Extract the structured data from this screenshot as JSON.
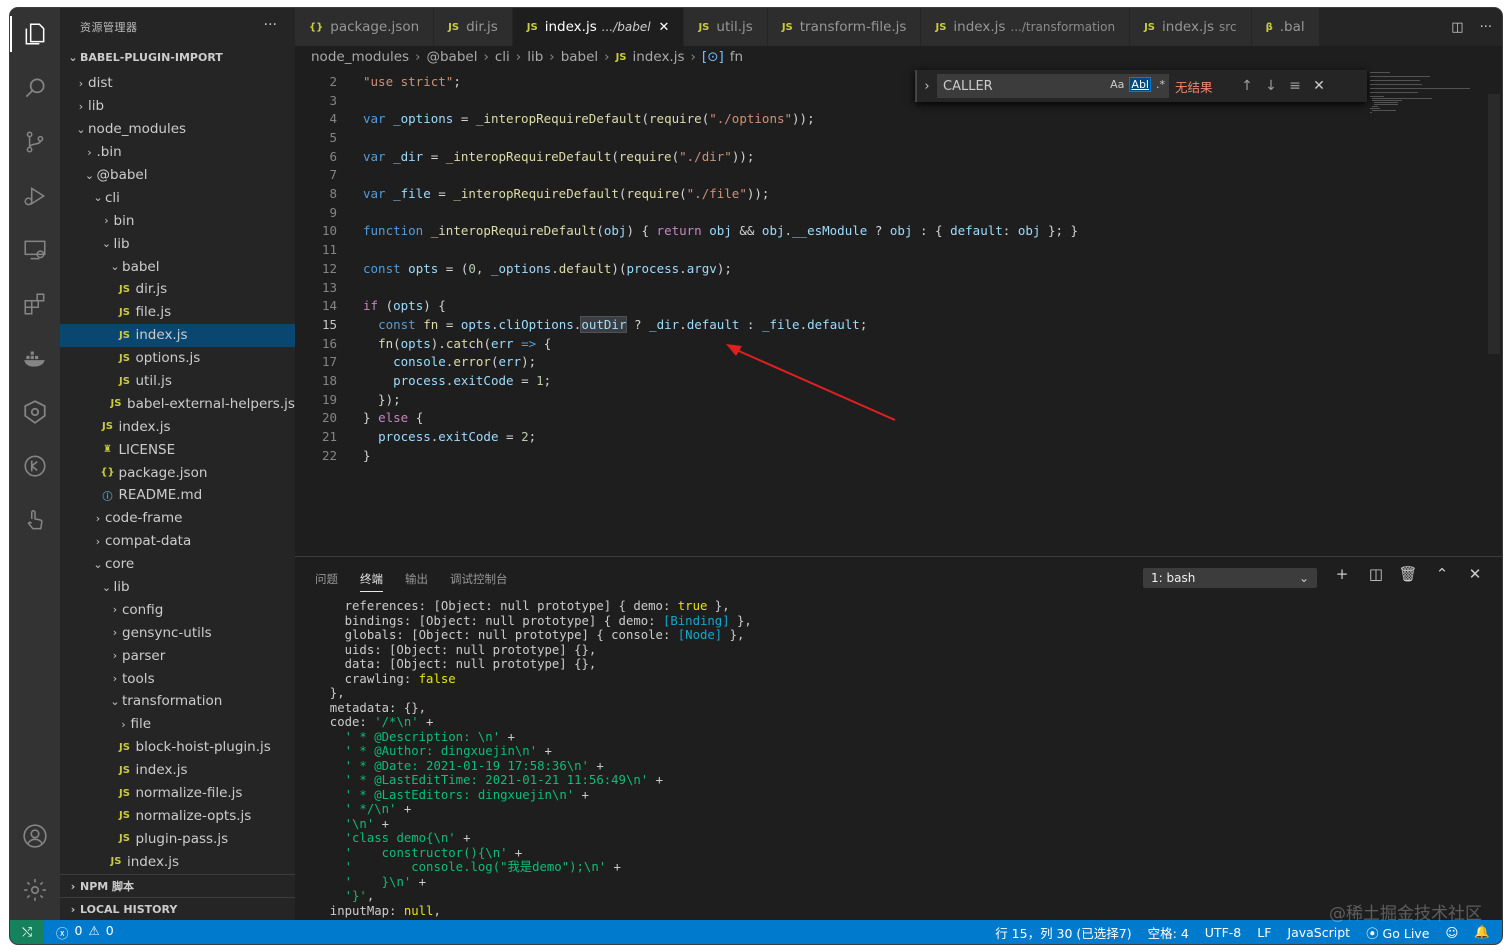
{
  "sidebar": {
    "title": "资源管理器",
    "more": "···",
    "root": "BABEL-PLUGIN-IMPORT",
    "tree": [
      {
        "depth": 0,
        "type": "folder",
        "open": false,
        "label": "dist"
      },
      {
        "depth": 0,
        "type": "folder",
        "open": false,
        "label": "lib"
      },
      {
        "depth": 0,
        "type": "folder",
        "open": true,
        "label": "node_modules"
      },
      {
        "depth": 1,
        "type": "folder",
        "open": false,
        "label": ".bin"
      },
      {
        "depth": 1,
        "type": "folder",
        "open": true,
        "label": "@babel"
      },
      {
        "depth": 2,
        "type": "folder",
        "open": true,
        "label": "cli"
      },
      {
        "depth": 3,
        "type": "folder",
        "open": false,
        "label": "bin"
      },
      {
        "depth": 3,
        "type": "folder",
        "open": true,
        "label": "lib"
      },
      {
        "depth": 4,
        "type": "folder",
        "open": true,
        "label": "babel"
      },
      {
        "depth": 5,
        "type": "js",
        "label": "dir.js"
      },
      {
        "depth": 5,
        "type": "js",
        "label": "file.js"
      },
      {
        "depth": 5,
        "type": "js",
        "label": "index.js",
        "selected": true
      },
      {
        "depth": 5,
        "type": "js",
        "label": "options.js"
      },
      {
        "depth": 5,
        "type": "js",
        "label": "util.js"
      },
      {
        "depth": 4,
        "type": "js",
        "label": "babel-external-helpers.js"
      },
      {
        "depth": 3,
        "type": "js",
        "label": "index.js"
      },
      {
        "depth": 3,
        "type": "license",
        "label": "LICENSE"
      },
      {
        "depth": 3,
        "type": "json",
        "label": "package.json"
      },
      {
        "depth": 3,
        "type": "info",
        "label": "README.md"
      },
      {
        "depth": 2,
        "type": "folder",
        "open": false,
        "label": "code-frame"
      },
      {
        "depth": 2,
        "type": "folder",
        "open": false,
        "label": "compat-data"
      },
      {
        "depth": 2,
        "type": "folder",
        "open": true,
        "label": "core"
      },
      {
        "depth": 3,
        "type": "folder",
        "open": true,
        "label": "lib"
      },
      {
        "depth": 4,
        "type": "folder",
        "open": false,
        "label": "config"
      },
      {
        "depth": 4,
        "type": "folder",
        "open": false,
        "label": "gensync-utils"
      },
      {
        "depth": 4,
        "type": "folder",
        "open": false,
        "label": "parser"
      },
      {
        "depth": 4,
        "type": "folder",
        "open": false,
        "label": "tools"
      },
      {
        "depth": 4,
        "type": "folder",
        "open": true,
        "label": "transformation"
      },
      {
        "depth": 5,
        "type": "folder",
        "open": false,
        "label": "file"
      },
      {
        "depth": 5,
        "type": "js",
        "label": "block-hoist-plugin.js"
      },
      {
        "depth": 5,
        "type": "js",
        "label": "index.js"
      },
      {
        "depth": 5,
        "type": "js",
        "label": "normalize-file.js"
      },
      {
        "depth": 5,
        "type": "js",
        "label": "normalize-opts.js"
      },
      {
        "depth": 5,
        "type": "js",
        "label": "plugin-pass.js"
      },
      {
        "depth": 4,
        "type": "js",
        "label": "index.js"
      }
    ],
    "npm_section": "NPM 脚本",
    "history_section": "LOCAL HISTORY"
  },
  "tabs": [
    {
      "icon": "{}",
      "label": "package.json",
      "hint": ""
    },
    {
      "icon": "JS",
      "label": "dir.js",
      "hint": ""
    },
    {
      "icon": "JS",
      "label": "index.js",
      "hint": ".../babel",
      "active": true
    },
    {
      "icon": "JS",
      "label": "util.js",
      "hint": ""
    },
    {
      "icon": "JS",
      "label": "transform-file.js",
      "hint": ""
    },
    {
      "icon": "JS",
      "label": "index.js",
      "hint": ".../transformation"
    },
    {
      "icon": "JS",
      "label": "index.js",
      "hint": "src"
    },
    {
      "icon": "β",
      "label": ".bal",
      "hint": ""
    }
  ],
  "breadcrumb": [
    "node_modules",
    "@babel",
    "cli",
    "lib",
    "babel",
    "index.js",
    "fn"
  ],
  "code": {
    "current_line": 15,
    "lines": [
      {
        "n": 2,
        "html": "<span class='str'>\"use strict\"</span>;"
      },
      {
        "n": 3,
        "html": ""
      },
      {
        "n": 4,
        "html": "<span class='kw'>var</span> <span class='var'>_options</span> = <span class='fn'>_interopRequireDefault</span>(<span class='fn'>require</span>(<span class='str'>\"./options\"</span>));"
      },
      {
        "n": 5,
        "html": ""
      },
      {
        "n": 6,
        "html": "<span class='kw'>var</span> <span class='var'>_dir</span> = <span class='fn'>_interopRequireDefault</span>(<span class='fn'>require</span>(<span class='str'>\"./dir\"</span>));"
      },
      {
        "n": 7,
        "html": ""
      },
      {
        "n": 8,
        "html": "<span class='kw'>var</span> <span class='var'>_file</span> = <span class='fn'>_interopRequireDefault</span>(<span class='fn'>require</span>(<span class='str'>\"./file\"</span>));"
      },
      {
        "n": 9,
        "html": ""
      },
      {
        "n": 10,
        "html": "<span class='kw'>function</span> <span class='fn'>_interopRequireDefault</span>(<span class='var'>obj</span>) { <span class='ctl'>return</span> <span class='var'>obj</span> &amp;&amp; <span class='var'>obj</span>.<span class='var'>__esModule</span> ? <span class='var'>obj</span> : { <span class='var'>default</span>: <span class='var'>obj</span> }; }"
      },
      {
        "n": 11,
        "html": ""
      },
      {
        "n": 12,
        "html": "<span class='kw'>const</span> <span class='var'>opts</span> = (<span class='num'>0</span>, <span class='var'>_options</span>.<span class='fn'>default</span>)(<span class='var'>process</span>.<span class='var'>argv</span>);"
      },
      {
        "n": 13,
        "html": ""
      },
      {
        "n": 14,
        "html": "<span class='ctl'>if</span> (<span class='var'>opts</span>) {"
      },
      {
        "n": 15,
        "html": "  <span class='kw'>const</span> <span class='fn'>fn</span> = <span class='var'>opts</span>.<span class='var'>cliOptions</span>.<span class='var hl'>outDir</span> ? <span class='var'>_dir</span>.<span class='var'>default</span> : <span class='var'>_file</span>.<span class='var'>default</span>;"
      },
      {
        "n": 16,
        "html": "  <span class='fn'>fn</span>(<span class='var'>opts</span>).<span class='fn'>catch</span>(<span class='var'>err</span> <span class='kw'>=&gt;</span> {"
      },
      {
        "n": 17,
        "html": "    <span class='var'>console</span>.<span class='fn'>error</span>(<span class='var'>err</span>);"
      },
      {
        "n": 18,
        "html": "    <span class='var'>process</span>.<span class='var'>exitCode</span> = <span class='num'>1</span>;"
      },
      {
        "n": 19,
        "html": "  });"
      },
      {
        "n": 20,
        "html": "} <span class='ctl'>else</span> {"
      },
      {
        "n": 21,
        "html": "  <span class='var'>process</span>.<span class='var'>exitCode</span> = <span class='num'>2</span>;"
      },
      {
        "n": 22,
        "html": "}"
      }
    ]
  },
  "find": {
    "value": "CALLER",
    "opt_case": "Aa",
    "opt_word": "Abl",
    "opt_regex": ".*",
    "result": "无结果"
  },
  "panel": {
    "tabs": [
      "问题",
      "终端",
      "输出",
      "调试控制台"
    ],
    "active_tab": 1,
    "terminal_select": "1: bash",
    "lines": [
      "    references: [Object: null prototype] { demo: <span class='ty'>true</span> },",
      "    bindings: [Object: null prototype] { demo: <span class='tc'>[Binding]</span> },",
      "    globals: [Object: null prototype] { console: <span class='tc'>[Node]</span> },",
      "    uids: [Object: null prototype] {},",
      "    data: [Object: null prototype] {},",
      "    crawling: <span class='ty'>false</span>",
      "  },",
      "  metadata: {},",
      "  code: <span class='tg'>'/*\\n'</span> +",
      "    <span class='tg'>' * @Description: \\n'</span> +",
      "    <span class='tg'>' * @Author: dingxuejin\\n'</span> +",
      "    <span class='tg'>' * @Date: 2021-01-19 17:58:36\\n'</span> +",
      "    <span class='tg'>' * @LastEditTime: 2021-01-21 11:56:49\\n'</span> +",
      "    <span class='tg'>' * @LastEditors: dingxuejin\\n'</span> +",
      "    <span class='tg'>' */\\n'</span> +",
      "    <span class='tg'>'\\n'</span> +",
      "    <span class='tg'>'class demo{\\n'</span> +",
      "    <span class='tg'>'    constructor(){\\n'</span> +",
      "    <span class='tg'>'        console.log(\"我是demo\");\\n'</span> +",
      "    <span class='tg'>'    }\\n'</span> +",
      "    <span class='tg'>'}'</span>,",
      "  inputMap: <span class='ty'>null</span>,"
    ]
  },
  "status": {
    "errors": "0",
    "warnings": "0",
    "position": "行 15，列 30 (已选择7)",
    "spaces": "空格: 4",
    "encoding": "UTF-8",
    "eol": "LF",
    "language": "JavaScript",
    "golive": "Go Live"
  },
  "watermark": "@稀土掘金技术社区"
}
